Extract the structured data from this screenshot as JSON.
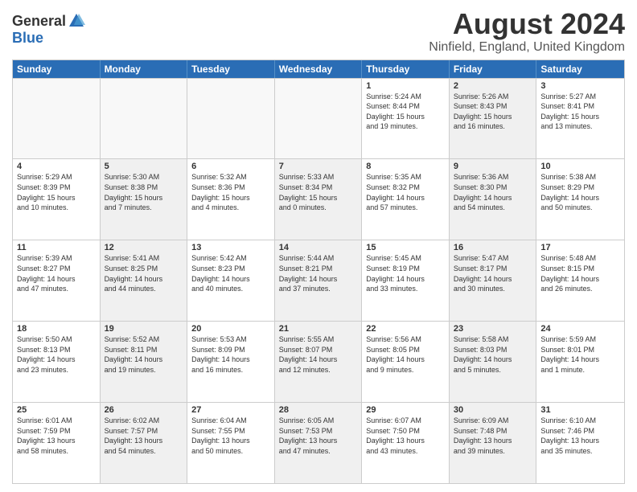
{
  "logo": {
    "general": "General",
    "blue": "Blue"
  },
  "header": {
    "title": "August 2024",
    "location": "Ninfield, England, United Kingdom"
  },
  "days_of_week": [
    "Sunday",
    "Monday",
    "Tuesday",
    "Wednesday",
    "Thursday",
    "Friday",
    "Saturday"
  ],
  "weeks": [
    [
      {
        "day": "",
        "info": "",
        "empty": true
      },
      {
        "day": "",
        "info": "",
        "empty": true
      },
      {
        "day": "",
        "info": "",
        "empty": true
      },
      {
        "day": "",
        "info": "",
        "empty": true
      },
      {
        "day": "1",
        "info": "Sunrise: 5:24 AM\nSunset: 8:44 PM\nDaylight: 15 hours\nand 19 minutes."
      },
      {
        "day": "2",
        "info": "Sunrise: 5:26 AM\nSunset: 8:43 PM\nDaylight: 15 hours\nand 16 minutes.",
        "shaded": true
      },
      {
        "day": "3",
        "info": "Sunrise: 5:27 AM\nSunset: 8:41 PM\nDaylight: 15 hours\nand 13 minutes."
      }
    ],
    [
      {
        "day": "4",
        "info": "Sunrise: 5:29 AM\nSunset: 8:39 PM\nDaylight: 15 hours\nand 10 minutes."
      },
      {
        "day": "5",
        "info": "Sunrise: 5:30 AM\nSunset: 8:38 PM\nDaylight: 15 hours\nand 7 minutes.",
        "shaded": true
      },
      {
        "day": "6",
        "info": "Sunrise: 5:32 AM\nSunset: 8:36 PM\nDaylight: 15 hours\nand 4 minutes."
      },
      {
        "day": "7",
        "info": "Sunrise: 5:33 AM\nSunset: 8:34 PM\nDaylight: 15 hours\nand 0 minutes.",
        "shaded": true
      },
      {
        "day": "8",
        "info": "Sunrise: 5:35 AM\nSunset: 8:32 PM\nDaylight: 14 hours\nand 57 minutes."
      },
      {
        "day": "9",
        "info": "Sunrise: 5:36 AM\nSunset: 8:30 PM\nDaylight: 14 hours\nand 54 minutes.",
        "shaded": true
      },
      {
        "day": "10",
        "info": "Sunrise: 5:38 AM\nSunset: 8:29 PM\nDaylight: 14 hours\nand 50 minutes."
      }
    ],
    [
      {
        "day": "11",
        "info": "Sunrise: 5:39 AM\nSunset: 8:27 PM\nDaylight: 14 hours\nand 47 minutes."
      },
      {
        "day": "12",
        "info": "Sunrise: 5:41 AM\nSunset: 8:25 PM\nDaylight: 14 hours\nand 44 minutes.",
        "shaded": true
      },
      {
        "day": "13",
        "info": "Sunrise: 5:42 AM\nSunset: 8:23 PM\nDaylight: 14 hours\nand 40 minutes."
      },
      {
        "day": "14",
        "info": "Sunrise: 5:44 AM\nSunset: 8:21 PM\nDaylight: 14 hours\nand 37 minutes.",
        "shaded": true
      },
      {
        "day": "15",
        "info": "Sunrise: 5:45 AM\nSunset: 8:19 PM\nDaylight: 14 hours\nand 33 minutes."
      },
      {
        "day": "16",
        "info": "Sunrise: 5:47 AM\nSunset: 8:17 PM\nDaylight: 14 hours\nand 30 minutes.",
        "shaded": true
      },
      {
        "day": "17",
        "info": "Sunrise: 5:48 AM\nSunset: 8:15 PM\nDaylight: 14 hours\nand 26 minutes."
      }
    ],
    [
      {
        "day": "18",
        "info": "Sunrise: 5:50 AM\nSunset: 8:13 PM\nDaylight: 14 hours\nand 23 minutes."
      },
      {
        "day": "19",
        "info": "Sunrise: 5:52 AM\nSunset: 8:11 PM\nDaylight: 14 hours\nand 19 minutes.",
        "shaded": true
      },
      {
        "day": "20",
        "info": "Sunrise: 5:53 AM\nSunset: 8:09 PM\nDaylight: 14 hours\nand 16 minutes."
      },
      {
        "day": "21",
        "info": "Sunrise: 5:55 AM\nSunset: 8:07 PM\nDaylight: 14 hours\nand 12 minutes.",
        "shaded": true
      },
      {
        "day": "22",
        "info": "Sunrise: 5:56 AM\nSunset: 8:05 PM\nDaylight: 14 hours\nand 9 minutes."
      },
      {
        "day": "23",
        "info": "Sunrise: 5:58 AM\nSunset: 8:03 PM\nDaylight: 14 hours\nand 5 minutes.",
        "shaded": true
      },
      {
        "day": "24",
        "info": "Sunrise: 5:59 AM\nSunset: 8:01 PM\nDaylight: 14 hours\nand 1 minute."
      }
    ],
    [
      {
        "day": "25",
        "info": "Sunrise: 6:01 AM\nSunset: 7:59 PM\nDaylight: 13 hours\nand 58 minutes."
      },
      {
        "day": "26",
        "info": "Sunrise: 6:02 AM\nSunset: 7:57 PM\nDaylight: 13 hours\nand 54 minutes.",
        "shaded": true
      },
      {
        "day": "27",
        "info": "Sunrise: 6:04 AM\nSunset: 7:55 PM\nDaylight: 13 hours\nand 50 minutes."
      },
      {
        "day": "28",
        "info": "Sunrise: 6:05 AM\nSunset: 7:53 PM\nDaylight: 13 hours\nand 47 minutes.",
        "shaded": true
      },
      {
        "day": "29",
        "info": "Sunrise: 6:07 AM\nSunset: 7:50 PM\nDaylight: 13 hours\nand 43 minutes."
      },
      {
        "day": "30",
        "info": "Sunrise: 6:09 AM\nSunset: 7:48 PM\nDaylight: 13 hours\nand 39 minutes.",
        "shaded": true
      },
      {
        "day": "31",
        "info": "Sunrise: 6:10 AM\nSunset: 7:46 PM\nDaylight: 13 hours\nand 35 minutes."
      }
    ]
  ]
}
